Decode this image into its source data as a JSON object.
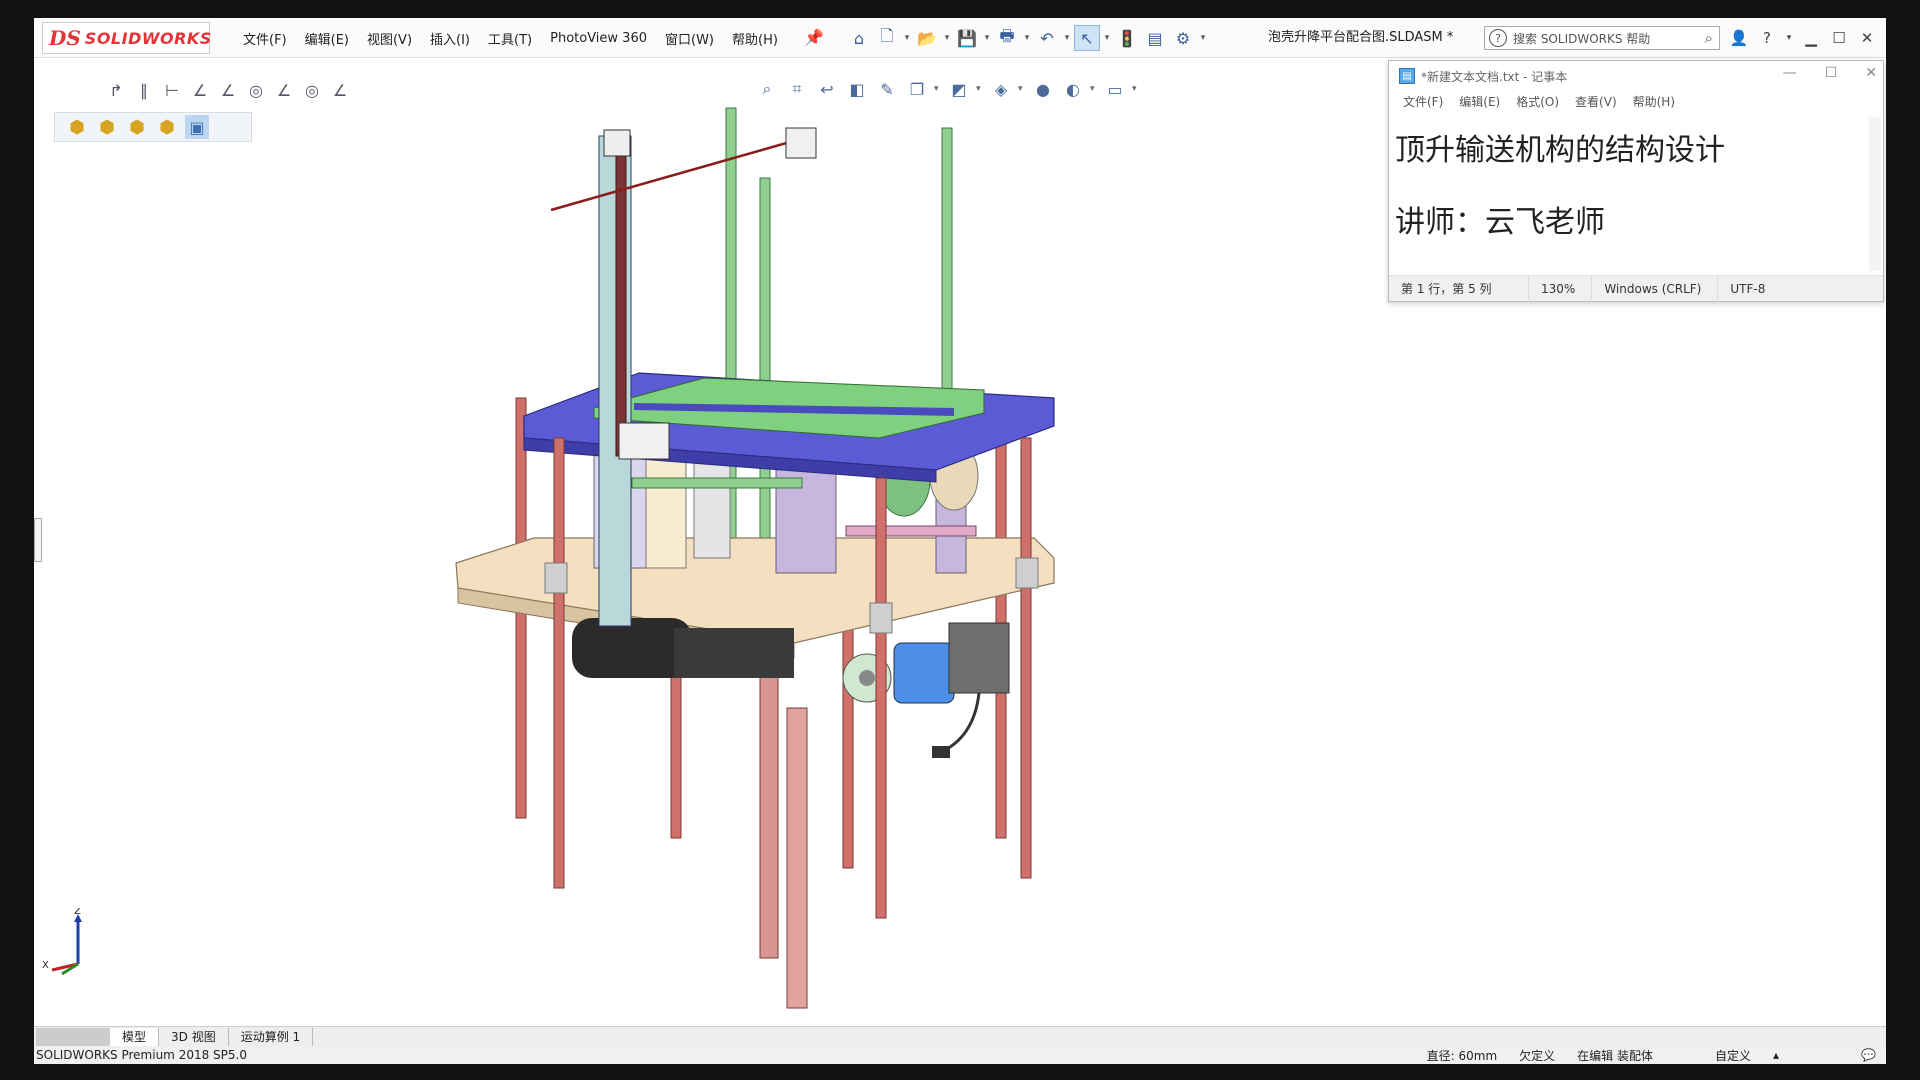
{
  "app": {
    "logo_ds": "DS",
    "logo_name": "SOLIDWORKS",
    "document_title": "泡壳升降平台配合图.SLDASM *",
    "search_placeholder": "搜索 SOLIDWORKS 帮助"
  },
  "menu": [
    "文件(F)",
    "编辑(E)",
    "视图(V)",
    "插入(I)",
    "工具(T)",
    "PhotoView 360",
    "窗口(W)",
    "帮助(H)"
  ],
  "notepad": {
    "title": "*新建文本文档.txt - 记事本",
    "menu": [
      "文件(F)",
      "编辑(E)",
      "格式(O)",
      "查看(V)",
      "帮助(H)"
    ],
    "lines": [
      "顶升输送机构的结构设计",
      "讲师：云飞老师"
    ],
    "status": {
      "position": "第 1 行，第 5 列",
      "zoom": "130%",
      "line_ending": "Windows (CRLF)",
      "encoding": "UTF-8"
    }
  },
  "tabs": [
    "模型",
    "3D 视图",
    "运动算例 1"
  ],
  "status_bar": {
    "product": "SOLIDWORKS Premium 2018 SP5.0",
    "measure": "直径: 60mm",
    "definition": "欠定义",
    "mode": "在编辑 装配体",
    "custom": "自定义"
  },
  "triad": {
    "z": "Z",
    "x": "X"
  },
  "colors": {
    "plate_blue": "#5b5bd6",
    "base_tan": "#f4dfc0",
    "rod_red": "#d0706a",
    "rod_green": "#8fcf90",
    "slider_purple": "#b9a8d8"
  }
}
